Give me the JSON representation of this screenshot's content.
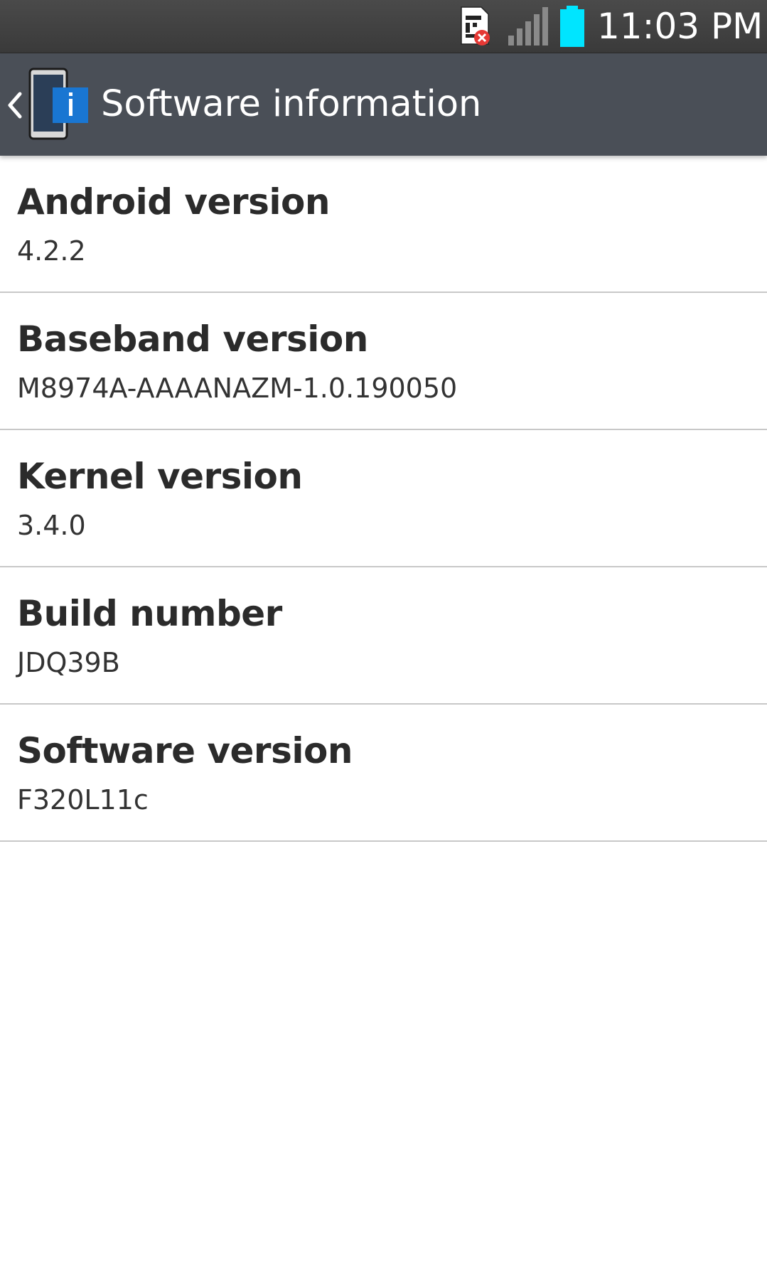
{
  "status_bar": {
    "time": "11:03 PM",
    "icons": [
      "sim-card-error-icon",
      "signal-strength-icon",
      "battery-icon"
    ],
    "battery_color": "#00e5ff"
  },
  "action_bar": {
    "title": "Software information",
    "back_icon": "chevron-left-icon",
    "app_icon": "phone-info-icon"
  },
  "items": [
    {
      "label": "Android version",
      "value": "4.2.2"
    },
    {
      "label": "Baseband version",
      "value": "M8974A-AAAANAZM-1.0.190050"
    },
    {
      "label": "Kernel version",
      "value": "3.4.0"
    },
    {
      "label": "Build number",
      "value": "JDQ39B"
    },
    {
      "label": "Software version",
      "value": "F320L11c"
    }
  ]
}
